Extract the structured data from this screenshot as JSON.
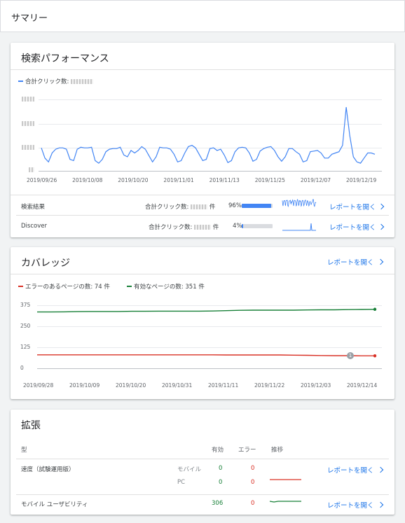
{
  "header": {
    "title": "サマリー"
  },
  "performance": {
    "title": "検索パフォーマンス",
    "legend_label": "合計クリック数: ",
    "x_ticks": [
      "2019/09/26",
      "2019/10/08",
      "2019/10/20",
      "2019/11/01",
      "2019/11/13",
      "2019/11/25",
      "2019/12/07",
      "2019/12/19"
    ],
    "rows": [
      {
        "label": "検索結果",
        "metric": "合計クリック数: ",
        "unit": "件",
        "pct": "96%",
        "pct_value": 96,
        "link": "レポートを開く"
      },
      {
        "label": "Discover",
        "metric": "合計クリック数: ",
        "unit": "件",
        "pct": "4%",
        "pct_value": 4,
        "link": "レポートを開く"
      }
    ],
    "colors": {
      "series": "#4285f4"
    }
  },
  "coverage": {
    "title": "カバレッジ",
    "link": "レポートを開く",
    "legend": [
      {
        "label": "エラーのあるページの数: 74 件",
        "color": "#d93025"
      },
      {
        "label": "有効なページの数: 351 件",
        "color": "#188038"
      }
    ],
    "y_ticks": [
      "375",
      "250",
      "125",
      "0"
    ],
    "x_ticks": [
      "2019/09/28",
      "2019/10/09",
      "2019/10/20",
      "2019/10/31",
      "2019/11/11",
      "2019/11/22",
      "2019/12/03",
      "2019/12/14"
    ],
    "annotation": "1"
  },
  "enhancements": {
    "title": "拡張",
    "headers": {
      "type": "型",
      "valid": "有効",
      "error": "エラー",
      "trend": "推移"
    },
    "rows": [
      {
        "name": "速度（試験運用版）",
        "link": "レポートを開く",
        "sub": [
          {
            "device": "モバイル",
            "valid": "0",
            "error": "0"
          },
          {
            "device": "PC",
            "valid": "0",
            "error": "0"
          }
        ]
      },
      {
        "name": "モバイル ユーザビリティ",
        "valid": "306",
        "error": "0",
        "link": "レポートを開く"
      }
    ]
  },
  "chart_data": [
    {
      "type": "line",
      "x": [
        "2019/09/24",
        "2019/09/25",
        "2019/09/26",
        "2019/09/27",
        "2019/09/28",
        "2019/09/29",
        "2019/09/30",
        "2019/10/01",
        "2019/10/02",
        "2019/10/03",
        "2019/10/04",
        "2019/10/05",
        "2019/10/06",
        "2019/10/07",
        "2019/10/08",
        "2019/10/09",
        "2019/10/10",
        "2019/10/11",
        "2019/10/12",
        "2019/10/13",
        "2019/10/14",
        "2019/10/15",
        "2019/10/16",
        "2019/10/17",
        "2019/10/18",
        "2019/10/19",
        "2019/10/20",
        "2019/10/21",
        "2019/10/22",
        "2019/10/23",
        "2019/10/24",
        "2019/10/25",
        "2019/10/26",
        "2019/10/27",
        "2019/10/28",
        "2019/10/29",
        "2019/10/30",
        "2019/10/31",
        "2019/11/01",
        "2019/11/02",
        "2019/11/03",
        "2019/11/04",
        "2019/11/05",
        "2019/11/06",
        "2019/11/07",
        "2019/11/08",
        "2019/11/09",
        "2019/11/10",
        "2019/11/11",
        "2019/11/12",
        "2019/11/13",
        "2019/11/14",
        "2019/11/15",
        "2019/11/16",
        "2019/11/17",
        "2019/11/18",
        "2019/11/19",
        "2019/11/20",
        "2019/11/21",
        "2019/11/22",
        "2019/11/23",
        "2019/11/24",
        "2019/11/25",
        "2019/11/26",
        "2019/11/27",
        "2019/11/28",
        "2019/11/29",
        "2019/11/30",
        "2019/12/01",
        "2019/12/02",
        "2019/12/03",
        "2019/12/04",
        "2019/12/05",
        "2019/12/06",
        "2019/12/07",
        "2019/12/08",
        "2019/12/09",
        "2019/12/10",
        "2019/12/11",
        "2019/12/12",
        "2019/12/13",
        "2019/12/14",
        "2019/12/15",
        "2019/12/16",
        "2019/12/17",
        "2019/12/18",
        "2019/12/19",
        "2019/12/20",
        "2019/12/21",
        "2019/12/22",
        "2019/12/23",
        "2019/12/24",
        "2019/12/25",
        "2019/12/26"
      ],
      "series": [
        {
          "name": "合計クリック数",
          "values": [
            0.36,
            0.2,
            0.14,
            0.28,
            0.34,
            0.36,
            0.36,
            0.34,
            0.18,
            0.16,
            0.34,
            0.37,
            0.36,
            0.36,
            0.37,
            0.16,
            0.12,
            0.18,
            0.3,
            0.34,
            0.35,
            0.35,
            0.37,
            0.25,
            0.22,
            0.32,
            0.28,
            0.32,
            0.38,
            0.34,
            0.24,
            0.14,
            0.22,
            0.37,
            0.36,
            0.36,
            0.34,
            0.26,
            0.14,
            0.16,
            0.28,
            0.38,
            0.4,
            0.36,
            0.26,
            0.16,
            0.18,
            0.35,
            0.36,
            0.32,
            0.34,
            0.25,
            0.13,
            0.16,
            0.3,
            0.36,
            0.37,
            0.36,
            0.28,
            0.15,
            0.18,
            0.31,
            0.35,
            0.37,
            0.38,
            0.32,
            0.22,
            0.15,
            0.22,
            0.35,
            0.35,
            0.3,
            0.26,
            0.14,
            0.16,
            0.3,
            0.31,
            0.32,
            0.28,
            0.2,
            0.2,
            0.26,
            0.28,
            0.3,
            0.4,
            1.0,
            0.55,
            0.22,
            0.14,
            0.12,
            0.2,
            0.28,
            0.28,
            0.26
          ]
        }
      ],
      "x_tick_labels": [
        "2019/09/26",
        "2019/10/08",
        "2019/10/20",
        "2019/11/01",
        "2019/11/13",
        "2019/11/25",
        "2019/12/07",
        "2019/12/19"
      ],
      "grid": true
    },
    {
      "type": "line",
      "x_tick_labels": [
        "2019/09/28",
        "2019/10/09",
        "2019/10/20",
        "2019/10/31",
        "2019/11/11",
        "2019/11/22",
        "2019/12/03",
        "2019/12/14"
      ],
      "ylim": [
        0,
        375
      ],
      "y_ticks": [
        0,
        125,
        250,
        375
      ],
      "series": [
        {
          "name": "有効なページの数",
          "color": "#188038",
          "values": [
            335,
            335,
            336,
            337,
            338,
            338,
            338,
            339,
            339,
            340,
            340,
            340,
            340,
            341,
            343,
            345,
            346,
            346,
            346,
            346,
            347,
            348,
            348,
            349,
            350,
            351
          ]
        },
        {
          "name": "エラーのあるページの数",
          "color": "#d93025",
          "values": [
            80,
            80,
            80,
            80,
            80,
            80,
            80,
            80,
            80,
            80,
            80,
            80,
            80,
            80,
            79,
            79,
            79,
            79,
            79,
            78,
            77,
            76,
            75,
            75,
            74,
            74
          ]
        }
      ],
      "grid": true,
      "legend": "top-left"
    }
  ]
}
